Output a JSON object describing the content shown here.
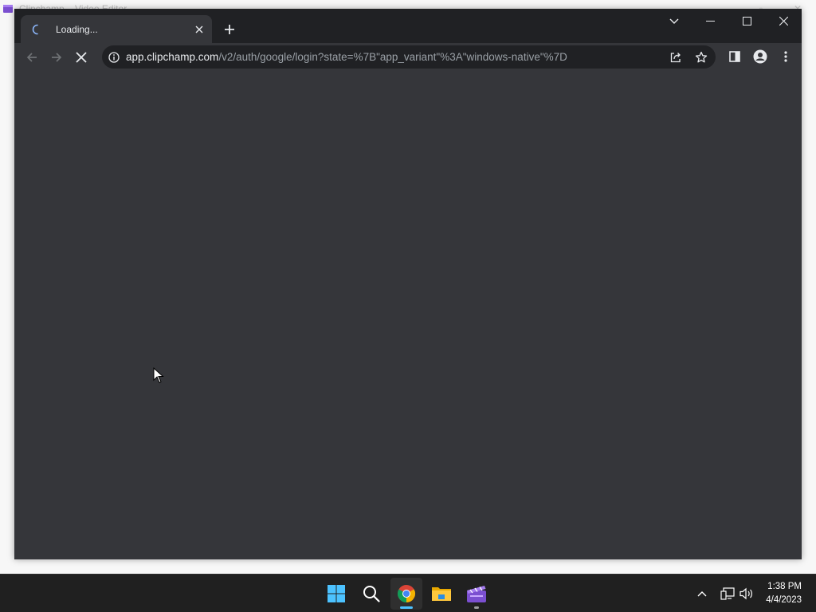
{
  "background_app": {
    "title": "Clipchamp – Video Editor"
  },
  "browser": {
    "tab": {
      "title": "Loading...",
      "icon": "loading-spinner-icon"
    },
    "address": {
      "host": "app.clipchamp.com",
      "path": "/v2/auth/google/login?state=%7B\"app_variant\"%3A\"windows-native\"%7D",
      "icon": "info-icon"
    },
    "colors": {
      "frame": "#202124",
      "toolbar": "#35363a",
      "content": "#35363a"
    }
  },
  "taskbar": {
    "apps": [
      {
        "name": "start",
        "icon": "windows-start-icon"
      },
      {
        "name": "search",
        "icon": "search-icon"
      },
      {
        "name": "chrome",
        "icon": "chrome-icon",
        "active": true
      },
      {
        "name": "file-explorer",
        "icon": "folder-icon"
      },
      {
        "name": "clipchamp",
        "icon": "clipchamp-icon"
      }
    ],
    "clock": {
      "time": "1:38 PM",
      "date": "4/4/2023"
    }
  }
}
